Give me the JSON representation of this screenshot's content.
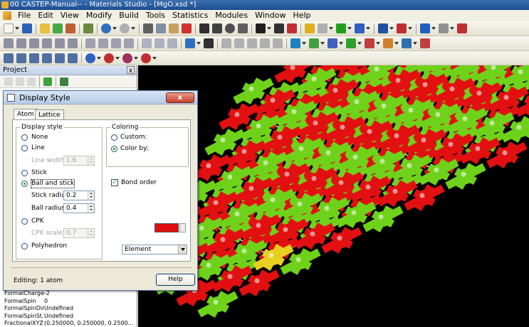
{
  "window": {
    "title": "00 CASTEP-Manual-- - Materials Studio - [MgO.xsd *]"
  },
  "menu": [
    "File",
    "Edit",
    "View",
    "Modify",
    "Build",
    "Tools",
    "Statistics",
    "Modules",
    "Window",
    "Help"
  ],
  "project": {
    "title": "Project",
    "close_label": "x"
  },
  "properties": [
    {
      "name": "FormalCharge",
      "value": "-2"
    },
    {
      "name": "FormalSpin",
      "value": "0"
    },
    {
      "name": "FormalSpinDir...",
      "value": "Undefined"
    },
    {
      "name": "FormalSpinSt...",
      "value": "Undefined"
    },
    {
      "name": "FractionalXYZ",
      "value": "(0.250000, 0.250000, 0.2500..."
    }
  ],
  "dialog": {
    "title": "Display Style",
    "close_label": "x",
    "tabs": [
      "Atom",
      "Lattice"
    ],
    "display_style": {
      "label": "Display style",
      "options": {
        "none": "None",
        "line": "Line",
        "line_width_label": "Line width:",
        "line_width_value": "1.6",
        "stick": "Stick",
        "ball_and_stick": "Ball and stick",
        "stick_radius_label": "Stick radius:",
        "stick_radius_value": "0.2",
        "ball_radius_label": "Ball radius:",
        "ball_radius_value": "0.4",
        "cpk": "CPK",
        "cpk_scale_label": "CPK scale:",
        "cpk_scale_value": "0.7",
        "polyhedron": "Polyhedron"
      },
      "selected": "ball_and_stick"
    },
    "coloring": {
      "label": "Coloring",
      "custom_label": "Custom:",
      "custom_color": "#e01010",
      "color_by_label": "Color by:",
      "color_by_value": "Element",
      "selected": "color_by"
    },
    "bond_order": {
      "label": "Bond order",
      "checked": true
    },
    "status": "Editing: 1 atom",
    "help_label": "Help"
  },
  "colors": {
    "magnesium": "#6fd21a",
    "oxygen": "#e21010",
    "selected_atom": "#e8d020",
    "lattice": "#ffffff"
  }
}
